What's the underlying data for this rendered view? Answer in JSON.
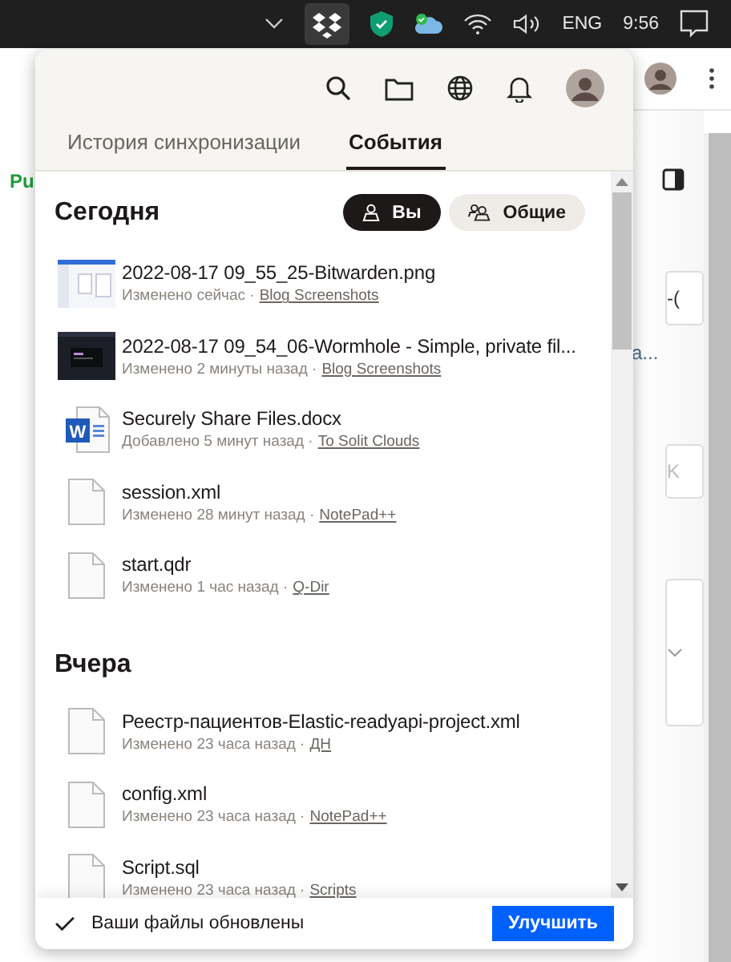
{
  "taskbar": {
    "language": "ENG",
    "time": "9:56"
  },
  "background_page": {
    "texts": [
      "Pu",
      "-(",
      "a...",
      "K"
    ]
  },
  "popup": {
    "tabs": [
      {
        "label": "История синхронизации",
        "selected": false
      },
      {
        "label": "События",
        "selected": true
      }
    ],
    "sections": [
      {
        "title": "Сегодня",
        "filters": [
          {
            "label": "Вы",
            "selected": true
          },
          {
            "label": "Общие",
            "selected": false
          }
        ],
        "items": [
          {
            "kind": "image-light",
            "name": "2022-08-17 09_55_25-Bitwarden.png",
            "status": "Изменено сейчас ·",
            "folder": "Blog Screenshots"
          },
          {
            "kind": "image-dark",
            "name": "2022-08-17 09_54_06-Wormhole - Simple, private fil...",
            "status": "Изменено 2 минуты назад ·",
            "folder": "Blog Screenshots"
          },
          {
            "kind": "word",
            "icon_letter": "W",
            "name": "Securely Share Files.docx",
            "status": "Добавлено 5 минут назад ·",
            "folder": "To Solit Clouds"
          },
          {
            "kind": "file",
            "name": "session.xml",
            "status": "Изменено 28 минут назад ·",
            "folder": "NotePad++"
          },
          {
            "kind": "file",
            "name": "start.qdr",
            "status": "Изменено 1 час назад ·",
            "folder": "Q-Dir"
          }
        ]
      },
      {
        "title": "Вчера",
        "items": [
          {
            "kind": "file",
            "name": "Реестр-пациентов-Elastic-readyapi-project.xml",
            "status": "Изменено 23 часа назад ·",
            "folder": "ДН"
          },
          {
            "kind": "file",
            "name": "config.xml",
            "status": "Изменено 23 часа назад ·",
            "folder": "NotePad++"
          },
          {
            "kind": "file",
            "name": "Script.sql",
            "status": "Изменено 23 часа назад ·",
            "folder": "Scripts"
          }
        ]
      }
    ],
    "footer": {
      "status": "Ваши файлы обновлены",
      "button": "Улучшить"
    }
  }
}
